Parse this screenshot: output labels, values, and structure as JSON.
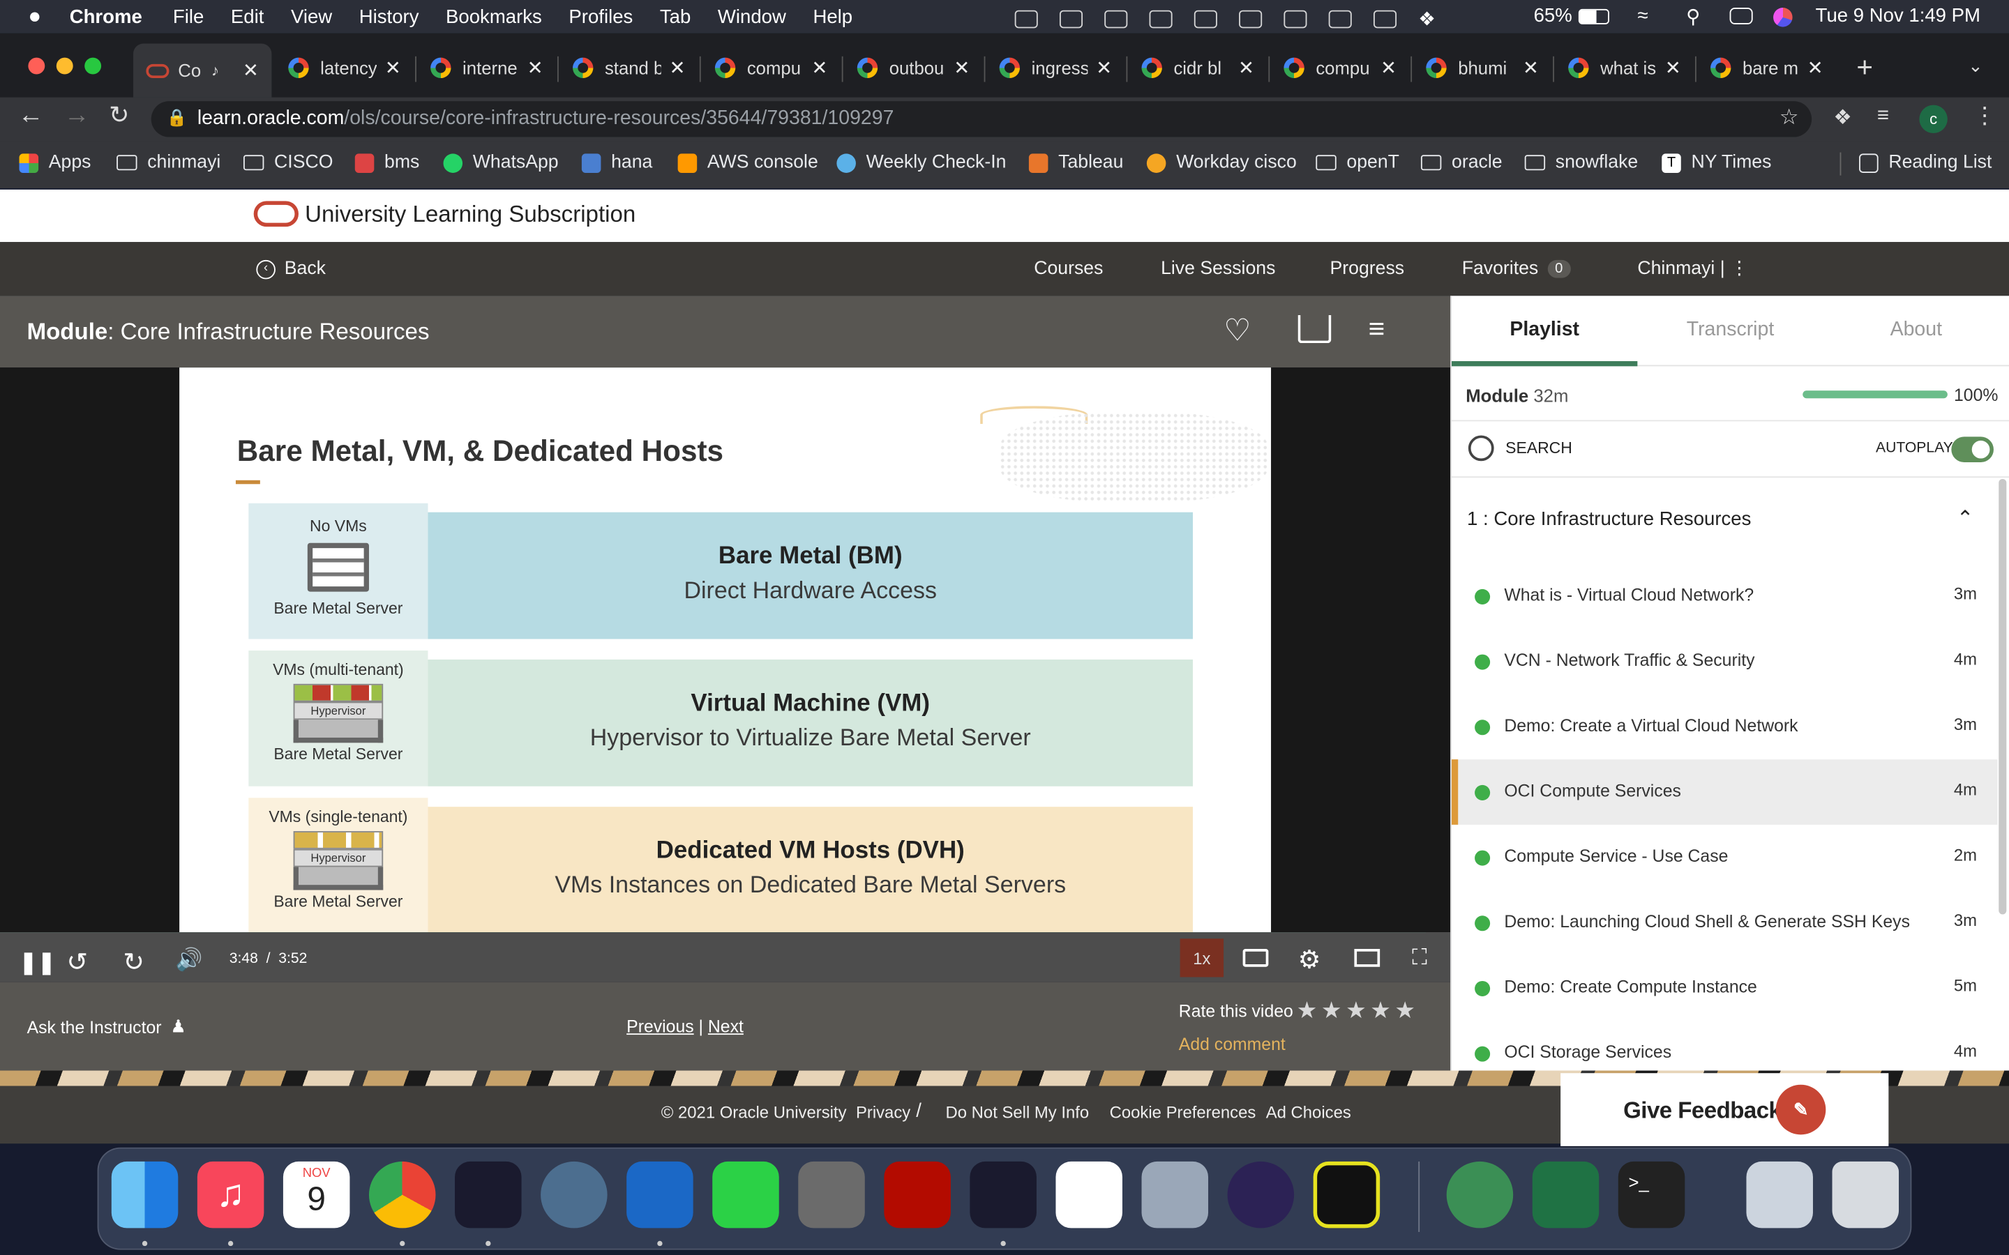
{
  "menubar": {
    "app": "Chrome",
    "menus": [
      "File",
      "Edit",
      "View",
      "History",
      "Bookmarks",
      "Profiles",
      "Tab",
      "Window",
      "Help"
    ],
    "battery": "65%",
    "datetime": "Tue 9 Nov  1:49 PM"
  },
  "tabs": [
    {
      "title": "Co",
      "active": true
    },
    {
      "title": "latency"
    },
    {
      "title": "interne"
    },
    {
      "title": "stand b"
    },
    {
      "title": "compu"
    },
    {
      "title": "outbou"
    },
    {
      "title": "ingress"
    },
    {
      "title": "cidr bl"
    },
    {
      "title": "compu"
    },
    {
      "title": "bhumi"
    },
    {
      "title": "what is"
    },
    {
      "title": "bare m"
    }
  ],
  "address": {
    "host": "learn.oracle.com",
    "path": "/ols/course/core-infrastructure-resources/35644/79381/109297"
  },
  "bookmarks": [
    "Apps",
    "chinmayi",
    "CISCO",
    "bms",
    "WhatsApp",
    "hana",
    "AWS console",
    "Weekly Check-In",
    "Tableau",
    "Workday cisco",
    "openT",
    "oracle",
    "snowflake",
    "NY Times",
    "Reading List"
  ],
  "page": {
    "brand": "University Learning Subscription",
    "nav": {
      "back": "Back",
      "courses": "Courses",
      "live": "Live Sessions",
      "progress": "Progress",
      "favorites": "Favorites",
      "fav_count": "0",
      "user": "Chinmayi"
    },
    "module_label": "Module",
    "module_title": ": Core Infrastructure Resources"
  },
  "slide": {
    "title": "Bare Metal, VM, & Dedicated Hosts",
    "rows": [
      {
        "left_top": "No VMs",
        "left_bottom": "Bare Metal Server",
        "title": "Bare Metal (BM)",
        "subtitle": "Direct Hardware Access",
        "bg": "#b6dbe3"
      },
      {
        "left_top": "VMs (multi-tenant)",
        "left_bottom": "Bare Metal Server",
        "title": "Virtual Machine (VM)",
        "subtitle": "Hypervisor to Virtualize Bare Metal Server",
        "bg": "#d4e8dd"
      },
      {
        "left_top": "VMs (single-tenant)",
        "left_bottom": "Bare Metal Server",
        "title": "Dedicated VM Hosts (DVH)",
        "subtitle": "VMs Instances on Dedicated Bare Metal Servers",
        "bg": "#f8e6c4"
      }
    ],
    "hypervisor": "Hypervisor"
  },
  "player": {
    "current": "3:48",
    "separator": "/",
    "duration": "3:52",
    "speed": "1x",
    "played_fraction": 0.983
  },
  "below": {
    "ask": "Ask the Instructor",
    "previous": "Previous",
    "next": "Next",
    "rate": "Rate this video",
    "comment": "Add comment"
  },
  "footer": {
    "copyright": "© 2021 Oracle University",
    "privacy": "Privacy",
    "donotsell": "Do Not Sell My Info",
    "cookies": "Cookie Preferences",
    "ads": "Ad Choices",
    "feedback": "Give Feedback"
  },
  "sidebar": {
    "tabs": [
      "Playlist",
      "Transcript",
      "About"
    ],
    "module_label": "Module",
    "module_duration": "32m",
    "module_percent": "100%",
    "search": "SEARCH",
    "autoplay": "AUTOPLAY",
    "section_num": "1 :",
    "section_title": "Core Infrastructure Resources",
    "items": [
      {
        "title": "What is - Virtual Cloud Network?",
        "dur": "3m"
      },
      {
        "title": "VCN - Network Traffic & Security",
        "dur": "4m"
      },
      {
        "title": "Demo: Create a Virtual Cloud Network",
        "dur": "3m"
      },
      {
        "title": "OCI Compute Services",
        "dur": "4m"
      },
      {
        "title": "Compute Service - Use Case",
        "dur": "2m"
      },
      {
        "title": "Demo: Launching Cloud Shell & Generate SSH Keys",
        "dur": "3m"
      },
      {
        "title": "Demo: Create Compute Instance",
        "dur": "5m"
      },
      {
        "title": "OCI Storage Services",
        "dur": "4m"
      }
    ]
  },
  "dock": {
    "calendar_month": "NOV",
    "calendar_day": "9"
  }
}
